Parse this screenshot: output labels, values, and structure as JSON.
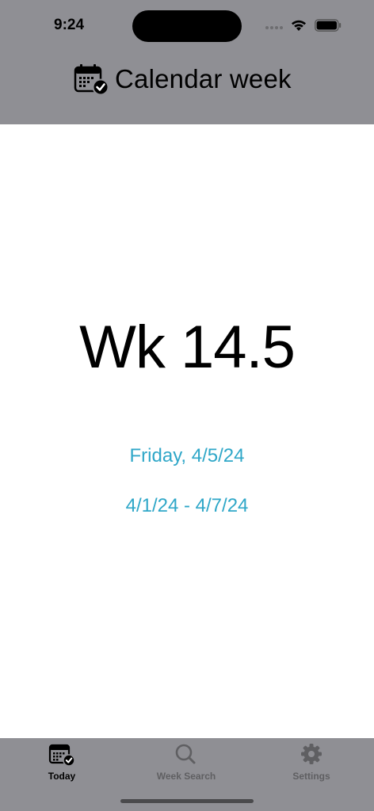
{
  "status_bar": {
    "time": "9:24"
  },
  "nav": {
    "title": "Calendar week",
    "icon": "calendar-check-icon"
  },
  "main": {
    "week_label": "Wk 14.5",
    "today_date": "Friday, 4/5/24",
    "week_range": "4/1/24 - 4/7/24"
  },
  "tabbar": {
    "tabs": [
      {
        "label": "Today",
        "icon": "calendar-check-icon",
        "selected": true
      },
      {
        "label": "Week Search",
        "icon": "magnifier-icon",
        "selected": false
      },
      {
        "label": "Settings",
        "icon": "gear-icon",
        "selected": false
      }
    ]
  },
  "colors": {
    "header_bg": "#8f8f94",
    "accent_date": "#2fa7c8",
    "background": "#ffffff"
  }
}
